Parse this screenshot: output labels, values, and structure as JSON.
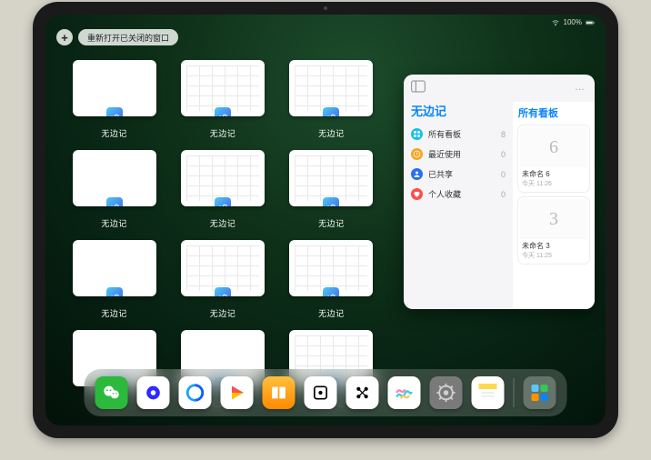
{
  "status": {
    "battery_label": "100%"
  },
  "top_buttons": {
    "plus_label": "+",
    "reopen_label": "重新打开已关闭的窗口"
  },
  "app_card_label": "无边记",
  "cards": [
    {
      "kind": "blank"
    },
    {
      "kind": "grid"
    },
    {
      "kind": "grid"
    },
    {
      "kind": "blank"
    },
    {
      "kind": "grid"
    },
    {
      "kind": "grid"
    },
    {
      "kind": "blank"
    },
    {
      "kind": "grid"
    },
    {
      "kind": "grid"
    },
    {
      "kind": "blank"
    },
    {
      "kind": "blank"
    },
    {
      "kind": "grid"
    }
  ],
  "panel": {
    "sidebar_icon": "sidebar-icon",
    "more_icon": "ellipsis-icon",
    "title": "无边记",
    "items": [
      {
        "icon": "grid-icon",
        "color": "#17c1e8",
        "label": "所有看板",
        "count": "8"
      },
      {
        "icon": "clock-icon",
        "color": "#f5a623",
        "label": "最近使用",
        "count": "0"
      },
      {
        "icon": "person-icon",
        "color": "#2b6ef2",
        "label": "已共享",
        "count": "0"
      },
      {
        "icon": "heart-icon",
        "color": "#ff4d4d",
        "label": "个人收藏",
        "count": "0"
      }
    ],
    "boards_heading": "所有看板",
    "boards": [
      {
        "glyph": "6",
        "name": "未命名 6",
        "date": "今天 11:26"
      },
      {
        "glyph": "3",
        "name": "未命名 3",
        "date": "今天 11:25"
      }
    ]
  },
  "dock": [
    {
      "name": "wechat",
      "bg": "#2cba3c",
      "glyph": "wechat"
    },
    {
      "name": "quark",
      "bg": "#ffffff",
      "glyph": "quark"
    },
    {
      "name": "qqbrowser",
      "bg": "#ffffff",
      "glyph": "qqbrowser"
    },
    {
      "name": "play",
      "bg": "#ffffff",
      "glyph": "play"
    },
    {
      "name": "books",
      "bg": "linear-gradient(180deg,#ffbf3d,#ff8a00)",
      "glyph": "books"
    },
    {
      "name": "dice",
      "bg": "#ffffff",
      "glyph": "dice"
    },
    {
      "name": "dots",
      "bg": "#ffffff",
      "glyph": "dots"
    },
    {
      "name": "freeform",
      "bg": "#ffffff",
      "glyph": "freeform"
    },
    {
      "name": "settings",
      "bg": "#7a7a7a",
      "glyph": "settings"
    },
    {
      "name": "notes",
      "bg": "#ffffff",
      "glyph": "notes"
    }
  ],
  "app_library_icon": "app-library-icon"
}
